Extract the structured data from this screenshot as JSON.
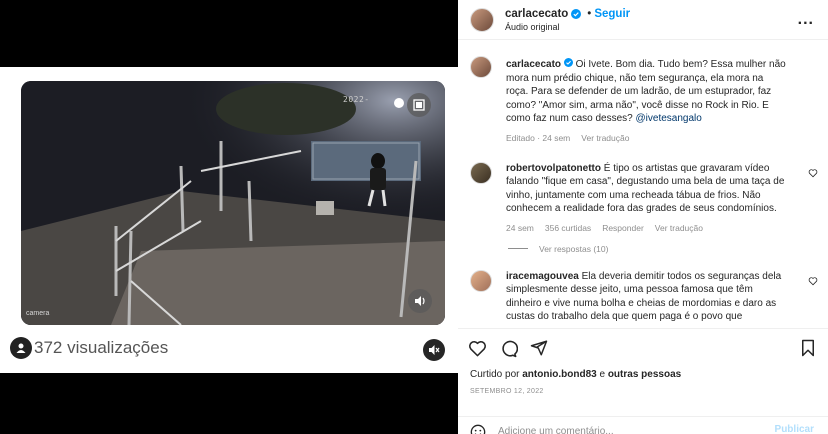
{
  "video": {
    "cam_timestamp": "2022-",
    "cam_label": "camera",
    "views": "372 visualizações"
  },
  "header": {
    "username": "carlacecato",
    "separator": "•",
    "follow_label": "Seguir",
    "audio": "Áudio original",
    "more": "..."
  },
  "caption": {
    "username": "carlacecato",
    "text": "Oi Ivete. Bom dia. Tudo bem? Essa mulher não mora num prédio chique, não tem segurança, ela mora na roça. Para se defender de um ladrão, de um estuprador, faz como? \"Amor sim, arma não\", você disse no Rock in Rio. E como faz num caso desses?",
    "mention": "@ivetesangalo",
    "edited": "Editado · 24 sem",
    "translate": "Ver tradução"
  },
  "comments": [
    {
      "username": "robertovolpatonetto",
      "text": "É tipo os artistas que gravaram vídeo falando \"fique em casa\", degustando uma bela de uma taça de vinho, juntamente com uma recheada tábua de frios. Não conhecem a realidade fora das grades de seus condomínios.",
      "time": "24 sem",
      "likes": "356 curtidas",
      "reply": "Responder",
      "translate": "Ver tradução",
      "view_replies": "Ver respostas (10)"
    },
    {
      "username": "iracemagouvea",
      "text": "Ela deveria demitir todos os seguranças dela simplesmente desse jeito, uma pessoa famosa que têm dinheiro e vive numa bolha e cheias de mordomias e daro as custas do trabalho dela que quem paga é o povo que"
    }
  ],
  "likes": {
    "prefix": "Curtido por",
    "user": "antonio.bond83",
    "middle": "e",
    "others": "outras pessoas"
  },
  "date": "SETEMBRO 12, 2022",
  "composer": {
    "placeholder": "Adicione um comentário...",
    "publish": "Publicar"
  },
  "colors": {
    "link": "#0095f6",
    "muted": "#8e8e8e",
    "text": "#262626"
  },
  "icons": [
    "verified-icon",
    "more-icon",
    "heart-icon",
    "comment-icon",
    "share-icon",
    "bookmark-icon",
    "emoji-icon",
    "mute-icon",
    "volume-icon",
    "video-menu-icon",
    "user-icon"
  ]
}
